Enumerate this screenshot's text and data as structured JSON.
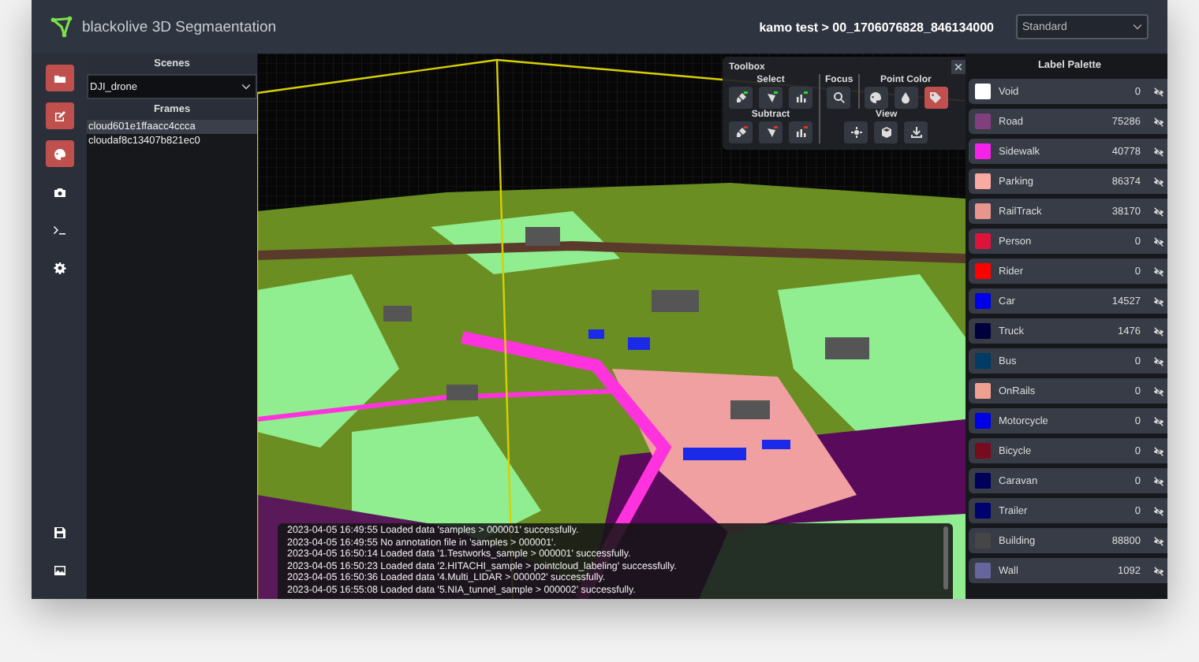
{
  "window": {
    "title": "blackolive 3D Segmaentation"
  },
  "header": {
    "breadcrumb": "kamo test > 00_1706076828_846134000",
    "mode_select": {
      "value": "Standard"
    }
  },
  "sidebar": {
    "top_items": [
      {
        "kind": "folder",
        "active": true
      },
      {
        "kind": "edit",
        "active": true
      },
      {
        "kind": "palette",
        "active": true
      },
      {
        "kind": "camera",
        "active": false
      },
      {
        "kind": "terminal",
        "active": false
      },
      {
        "kind": "gear",
        "active": false
      }
    ],
    "bottom_items": [
      {
        "kind": "save",
        "active": false
      },
      {
        "kind": "image",
        "active": false
      }
    ]
  },
  "scenes": {
    "title": "Scenes",
    "select": {
      "value": "DJI_drone"
    }
  },
  "frames": {
    "title": "Frames",
    "items": [
      {
        "label": "cloud601e1ffaacc4ccca",
        "selected": true
      },
      {
        "label": "cloudaf8c13407b821ec0",
        "selected": false
      }
    ]
  },
  "toolbox": {
    "title": "Toolbox",
    "select": {
      "title": "Select",
      "kind": "add",
      "buttons": [
        {
          "kind": "brush"
        },
        {
          "kind": "polygon"
        },
        {
          "kind": "bars"
        }
      ]
    },
    "subtract": {
      "title": "Subtract",
      "kind": "subtract",
      "buttons": [
        {
          "kind": "brush"
        },
        {
          "kind": "polygon"
        },
        {
          "kind": "bars"
        }
      ]
    },
    "focus": {
      "title": "Focus",
      "buttons": [
        {
          "kind": "search"
        }
      ]
    },
    "point_color": {
      "title": "Point Color",
      "buttons": [
        {
          "kind": "palette",
          "selected": false
        },
        {
          "kind": "drop",
          "selected": false
        },
        {
          "kind": "tag",
          "selected": true
        }
      ]
    },
    "view": {
      "title": "View",
      "buttons": [
        {
          "kind": "crosshair"
        },
        {
          "kind": "cube"
        },
        {
          "kind": "download"
        }
      ]
    }
  },
  "log": {
    "lines": [
      "2023-04-05 16:49:55 Loaded data 'samples > 000001' successfully.",
      "2023-04-05 16:49:55 No annotation file in 'samples > 000001'.",
      "2023-04-05 16:50:14 Loaded data '1.Testworks_sample > 000001' successfully.",
      "2023-04-05 16:50:23 Loaded data '2.HITACHI_sample > pointcloud_labeling' successfully.",
      "2023-04-05 16:50:36 Loaded data '4.Multi_LIDAR > 000002' successfully.",
      "2023-04-05 16:55:08 Loaded data '5.NIA_tunnel_sample > 000002' successfully."
    ]
  },
  "label_palette": {
    "title": "Label Palette",
    "labels": [
      {
        "name": "Void",
        "color": "#ffffff",
        "count": "0"
      },
      {
        "name": "Road",
        "color": "#804080",
        "count": "75286"
      },
      {
        "name": "Sidewalk",
        "color": "#f423e8",
        "count": "40778"
      },
      {
        "name": "Parking",
        "color": "#faaaa0",
        "count": "86374"
      },
      {
        "name": "RailTrack",
        "color": "#e6968c",
        "count": "38170"
      },
      {
        "name": "Person",
        "color": "#dc143c",
        "count": "0"
      },
      {
        "name": "Rider",
        "color": "#ff0000",
        "count": "0"
      },
      {
        "name": "Car",
        "color": "#0000e8",
        "count": "14527"
      },
      {
        "name": "Truck",
        "color": "#00003c",
        "count": "1476"
      },
      {
        "name": "Bus",
        "color": "#003c64",
        "count": "0"
      },
      {
        "name": "OnRails",
        "color": "#f0a090",
        "count": "0"
      },
      {
        "name": "Motorcycle",
        "color": "#0000e6",
        "count": "0"
      },
      {
        "name": "Bicycle",
        "color": "#770b20",
        "count": "0"
      },
      {
        "name": "Caravan",
        "color": "#00005a",
        "count": "0"
      },
      {
        "name": "Trailer",
        "color": "#00006e",
        "count": "0"
      },
      {
        "name": "Building",
        "color": "#464646",
        "count": "88800"
      },
      {
        "name": "Wall",
        "color": "#66669c",
        "count": "1092"
      }
    ]
  }
}
